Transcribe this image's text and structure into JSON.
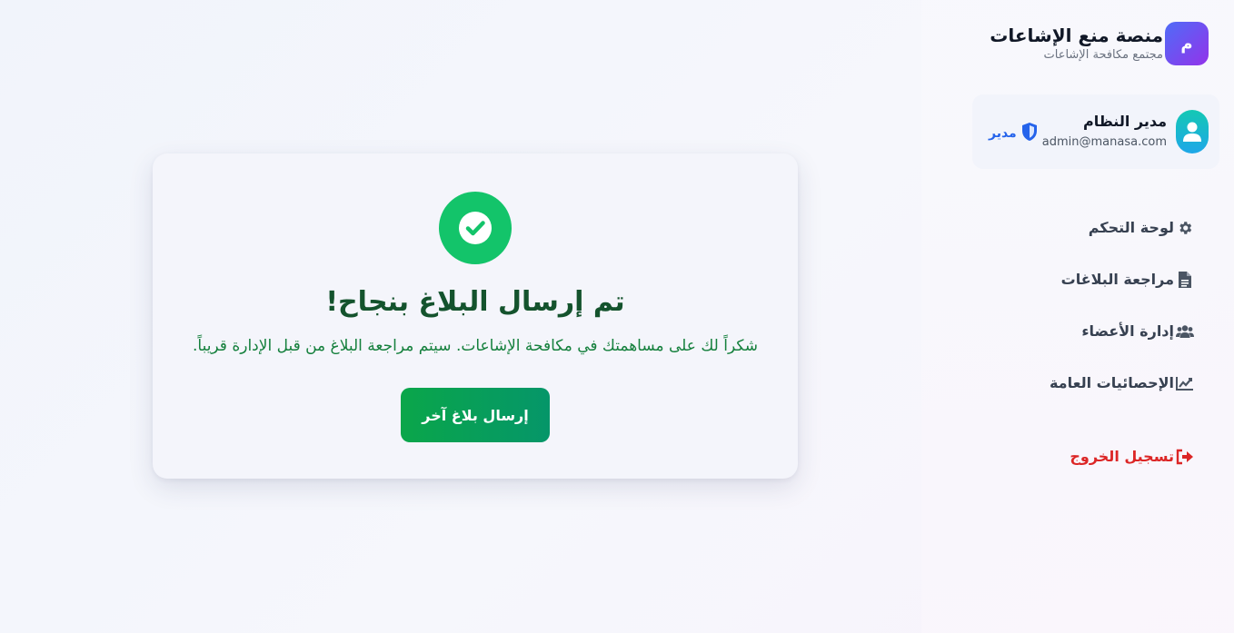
{
  "brand": {
    "logo_letter": "م",
    "title": "منصة منع الإشاعات",
    "subtitle": "مجتمع مكافحة الإشاعات",
    "colors": {
      "from": "#4f6cf7",
      "to": "#9333ea"
    }
  },
  "user": {
    "name": "مدير النظام",
    "email": "admin@manasa.com",
    "role": "مدير",
    "avatar_icon": "user-icon",
    "role_icon": "shield-icon"
  },
  "nav": {
    "items": [
      {
        "label": "لوحة التحكم",
        "icon": "gear-icon"
      },
      {
        "label": "مراجعة البلاغات",
        "icon": "document-icon"
      },
      {
        "label": "إدارة الأعضاء",
        "icon": "users-icon"
      },
      {
        "label": "الإحصائيات العامة",
        "icon": "chart-icon"
      }
    ],
    "logout": {
      "label": "تسجيل الخروج",
      "icon": "logout-icon",
      "color": "#dc2626"
    }
  },
  "success": {
    "icon": "check-circle-icon",
    "title": "تم إرسال البلاغ بنجاح!",
    "message": "شكراً لك على مساهمتك في مكافحة الإشاعات. سيتم مراجعة البلاغ من قبل الإدارة قريباً.",
    "button_label": "إرسال بلاغ آخر",
    "accent": "#13c46a"
  }
}
